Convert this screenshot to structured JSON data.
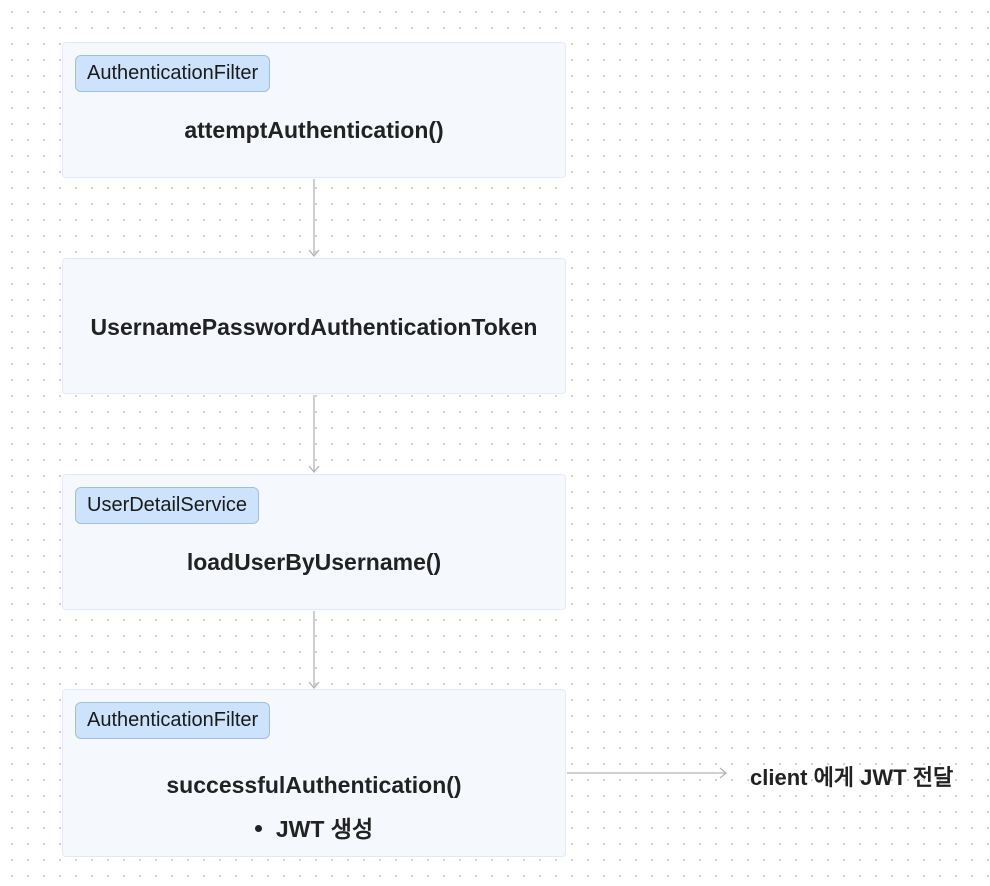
{
  "nodes": [
    {
      "tag": "AuthenticationFilter",
      "text": "attemptAuthentication()"
    },
    {
      "tag": "",
      "text": "UsernamePasswordAuthenticationToken"
    },
    {
      "tag": "UserDetailService",
      "text": "loadUserByUsername()"
    },
    {
      "tag": "AuthenticationFilter",
      "text": "successfulAuthentication()",
      "bullet": "JWT 생성"
    }
  ],
  "side_label": "client 에게 JWT 전달",
  "colors": {
    "node_fill": "#f5f9fd",
    "tag_fill": "#cde3fb",
    "tag_border": "#9fbfdf",
    "connector": "#b5b5b5"
  }
}
